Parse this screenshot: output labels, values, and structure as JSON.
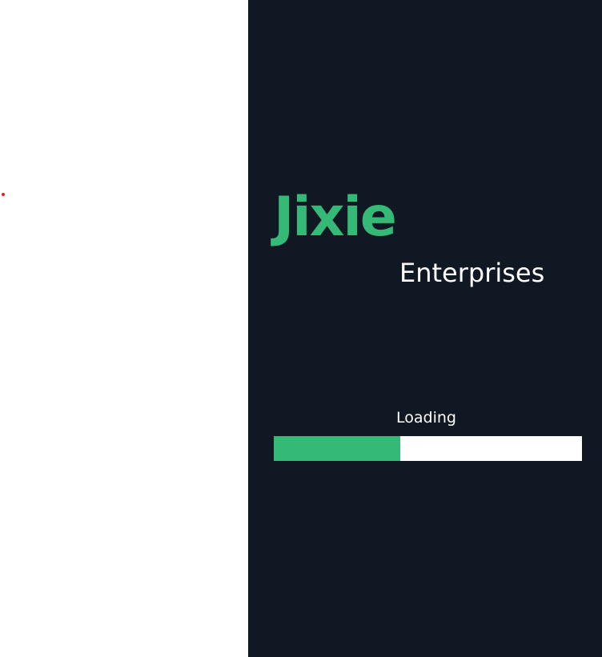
{
  "brand": {
    "name": "Jixie",
    "subtitle": "Enterprises"
  },
  "loading": {
    "label": "Loading",
    "progress": 0.41
  },
  "colors": {
    "splash_background": "#101823",
    "accent": "#35b977",
    "text": "#ffffff",
    "track": "#ffffff",
    "marker": "#e02020"
  }
}
